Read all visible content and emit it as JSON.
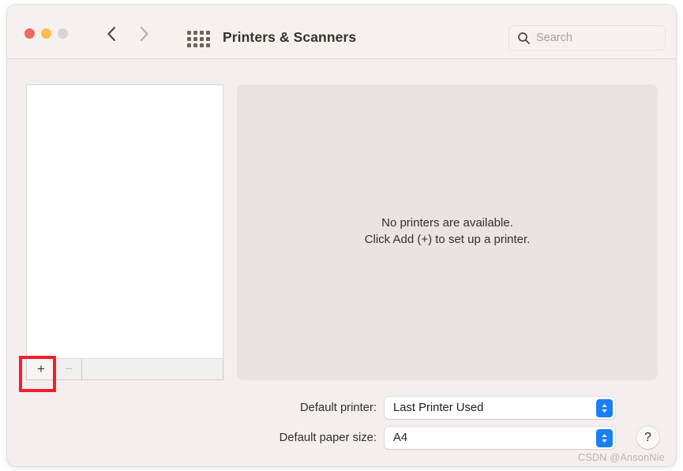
{
  "window": {
    "title": "Printers & Scanners",
    "accent_color": "#1a7ef5",
    "background_color": "#f4efee",
    "highlight_color": "#f41e2b"
  },
  "titlebar": {
    "traffic_lights": [
      {
        "name": "close",
        "color": "#ed6a5e"
      },
      {
        "name": "minimize",
        "color": "#f5bf4f"
      },
      {
        "name": "zoom",
        "color": "#d9d5d4"
      }
    ],
    "back_label": "Back",
    "forward_label": "Forward",
    "show_all_label": "Show All",
    "title": "Printers & Scanners"
  },
  "search": {
    "placeholder": "Search",
    "value": "",
    "icon": "search-icon"
  },
  "printer_list": {
    "items": [],
    "toolbar": {
      "add_label": "+",
      "remove_label": "−"
    }
  },
  "detail": {
    "empty_line1": "No printers are available.",
    "empty_line2": "Click Add (+) to set up a printer."
  },
  "settings": {
    "default_printer": {
      "label": "Default printer:",
      "value": "Last Printer Used"
    },
    "default_paper_size": {
      "label": "Default paper size:",
      "value": "A4"
    }
  },
  "help": {
    "label": "?"
  },
  "watermark": {
    "text": "CSDN @AnsonNie"
  }
}
